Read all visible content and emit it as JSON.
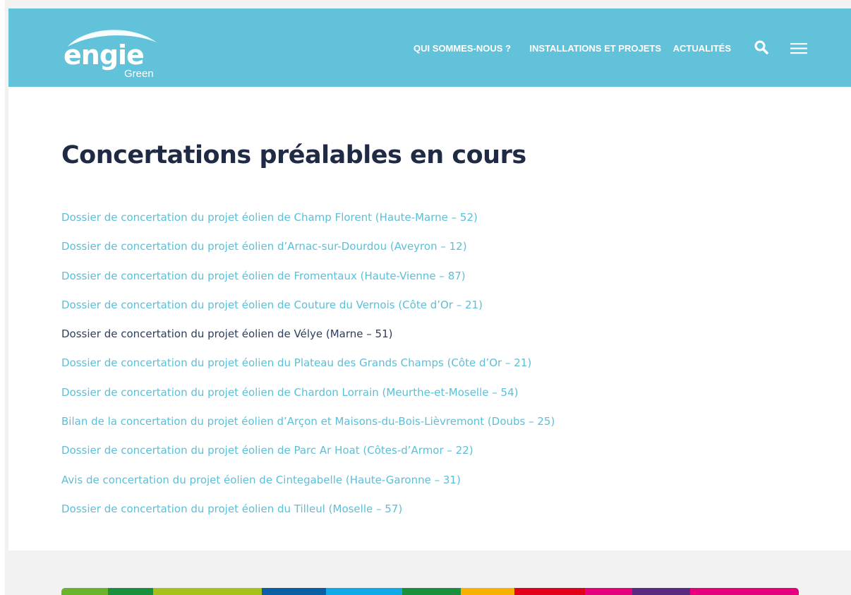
{
  "header": {
    "logo": {
      "word": "engie",
      "sub": "Green"
    },
    "nav": [
      {
        "label": "QUI SOMMES-NOUS ?"
      },
      {
        "label": "INSTALLATIONS ET PROJETS"
      },
      {
        "label": "ACTUALITÉS"
      }
    ],
    "icons": [
      "search-icon",
      "menu-icon"
    ],
    "background": "#62c2da"
  },
  "main": {
    "title": "Concertations préalables en cours",
    "items": [
      {
        "label": "Dossier de concertation du projet éolien de Champ Florent (Haute-Marne – 52)"
      },
      {
        "label": "Dossier de concertation du projet éolien d’Arnac-sur-Dourdou (Aveyron – 12)"
      },
      {
        "label": "Dossier de concertation du projet éolien de Fromentaux (Haute-Vienne – 87)"
      },
      {
        "label": "Dossier de concertation du projet éolien de Couture du Vernois (Côte d’Or – 21)"
      },
      {
        "label": "Dossier de concertation du projet éolien de Vélye (Marne – 51)",
        "visited": true
      },
      {
        "label": "Dossier de concertation du projet éolien du Plateau des Grands Champs (Côte d’Or – 21)"
      },
      {
        "label": "Dossier de concertation du projet éolien de Chardon Lorrain (Meurthe-et-Moselle – 54)"
      },
      {
        "label": "Bilan de la concertation du projet éolien d’Arçon et Maisons-du-Bois-Lièvremont (Doubs – 25)"
      },
      {
        "label": "Dossier de concertation du projet éolien de Parc Ar Hoat (Côtes-d’Armor – 22)"
      },
      {
        "label": "Avis de concertation du projet éolien de Cintegabelle (Haute-Garonne – 31)"
      },
      {
        "label": "Dossier de concertation du projet éolien du Tilleul (Moselle – 57)"
      }
    ],
    "link_color": "#5bbfd8",
    "visited_color": "#2c3e5c",
    "title_color": "#1f2a44"
  },
  "footer": {
    "color_bar": [
      "#6ab42d",
      "#1a8f3c",
      "#a7c11c",
      "#0b5fa5",
      "#0fa9e6",
      "#1a8f3c",
      "#f9b000",
      "#e2001a",
      "#e6007e",
      "#5a2a82",
      "#e6007e"
    ]
  }
}
